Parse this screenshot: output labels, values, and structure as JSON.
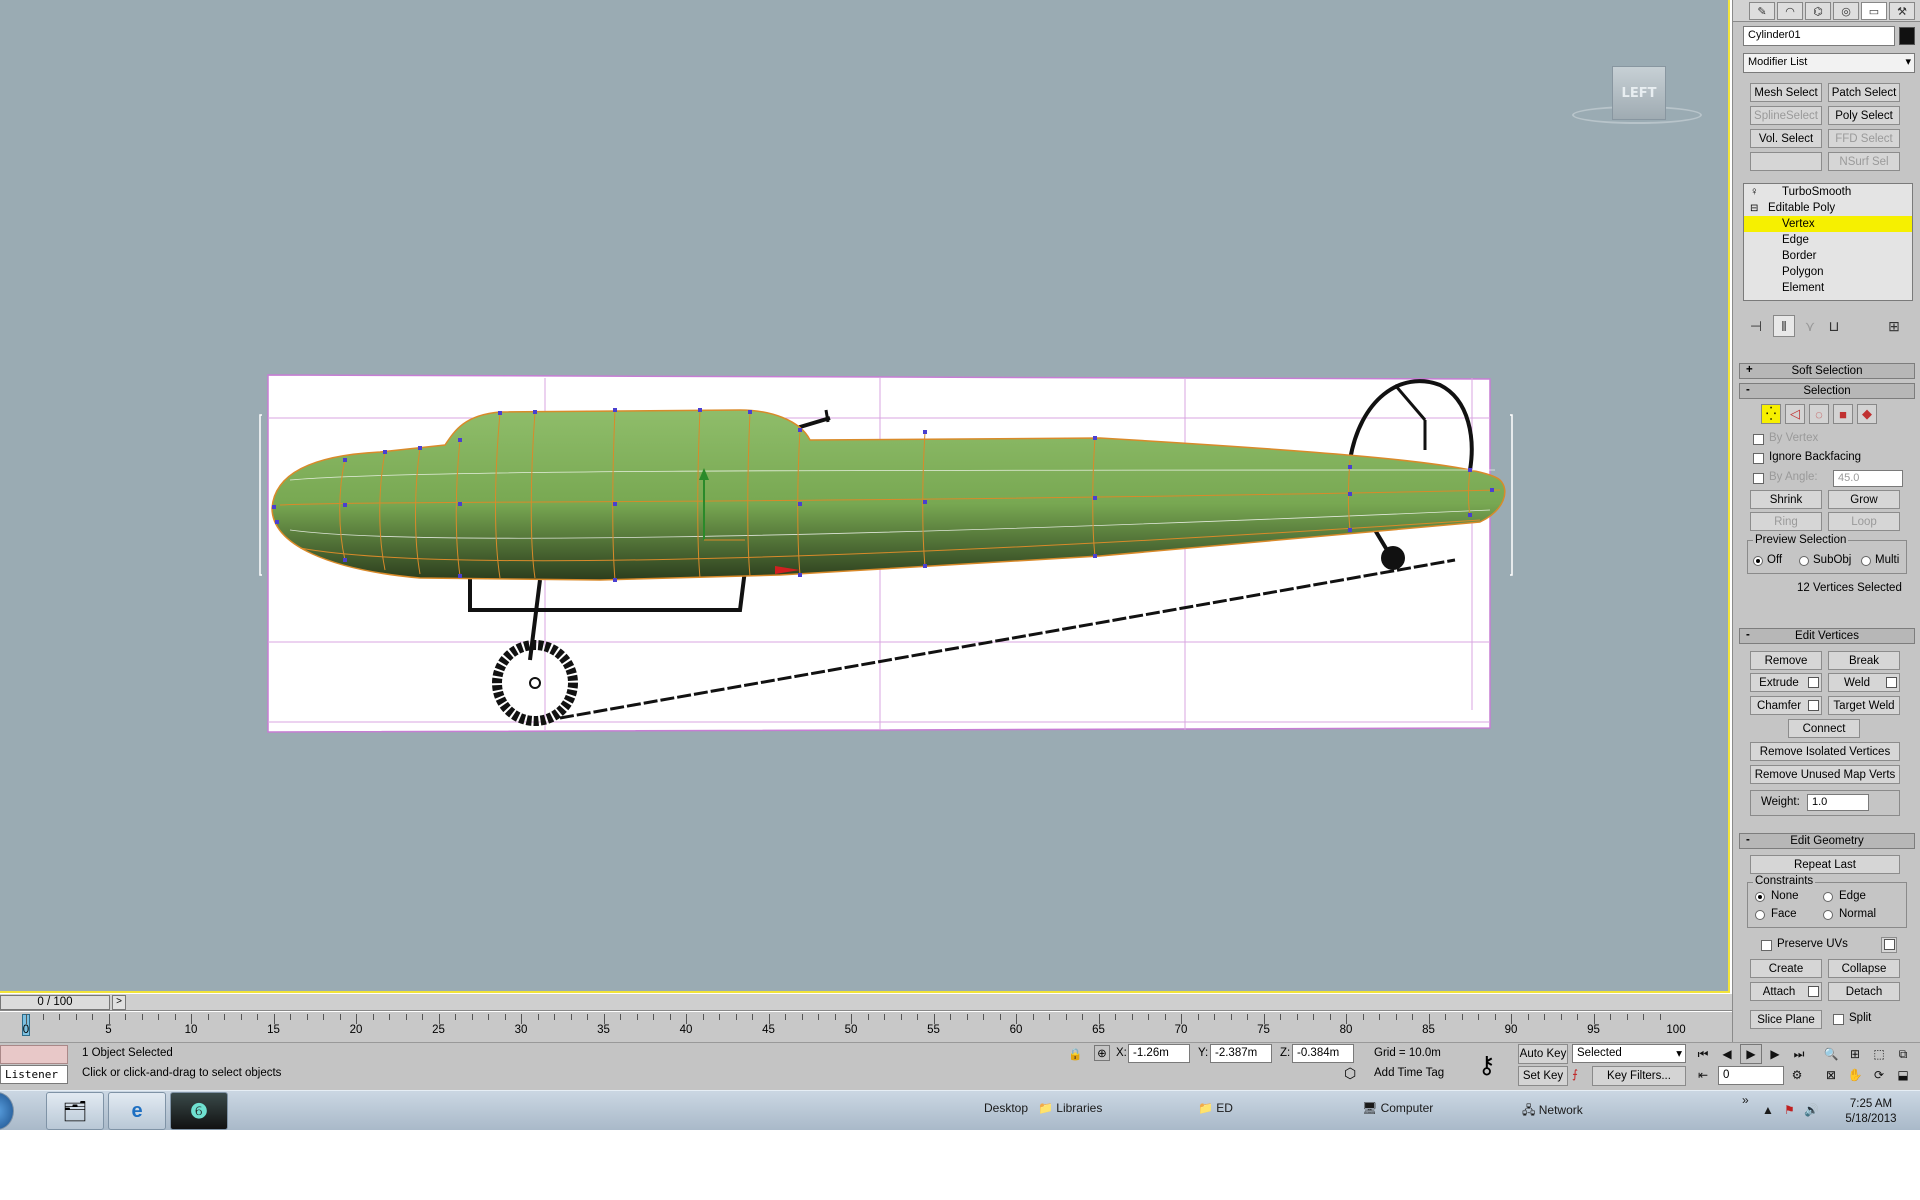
{
  "viewport": {
    "viewcube_label": "LEFT",
    "colors": {
      "background": "#9aabb3",
      "fuselage": "#7fae5a",
      "mesh_lines": "#d98a2a",
      "vertex": "#4a3fd0"
    }
  },
  "command_panel": {
    "tabs": [
      "create-icon",
      "modify-icon",
      "hierarchy-icon",
      "motion-icon",
      "display-icon",
      "utilities-icon"
    ],
    "object_name": "Cylinder01",
    "modifier_list": "Modifier List",
    "modifier_buttons": [
      {
        "label": "Mesh Select",
        "enabled": true
      },
      {
        "label": "Patch Select",
        "enabled": true
      },
      {
        "label": "SplineSelect",
        "enabled": false
      },
      {
        "label": "Poly Select",
        "enabled": true
      },
      {
        "label": "Vol. Select",
        "enabled": true
      },
      {
        "label": "FFD Select",
        "enabled": false
      },
      {
        "label": "",
        "enabled": false
      },
      {
        "label": "NSurf Sel",
        "enabled": false
      }
    ],
    "stack": {
      "turbosmooth": "TurboSmooth",
      "editable_poly": "Editable Poly",
      "subobjects": [
        "Vertex",
        "Edge",
        "Border",
        "Polygon",
        "Element"
      ],
      "selected": "Vertex"
    },
    "soft_selection": {
      "title": "Soft Selection",
      "sign": "+"
    },
    "selection": {
      "title": "Selection",
      "sign": "-",
      "by_vertex": "By Vertex",
      "ignore_backfacing": "Ignore Backfacing",
      "by_angle": "By Angle:",
      "angle_value": "45.0",
      "shrink": "Shrink",
      "grow": "Grow",
      "ring": "Ring",
      "loop": "Loop",
      "preview_selection": "Preview Selection",
      "preview_off": "Off",
      "preview_subobj": "SubObj",
      "preview_multi": "Multi",
      "status": "12 Vertices Selected"
    },
    "edit_vertices": {
      "title": "Edit Vertices",
      "sign": "-",
      "remove": "Remove",
      "break": "Break",
      "extrude": "Extrude",
      "weld": "Weld",
      "chamfer": "Chamfer",
      "target_weld": "Target Weld",
      "connect": "Connect",
      "remove_isolated": "Remove Isolated Vertices",
      "remove_unused": "Remove Unused Map Verts",
      "weight_label": "Weight:",
      "weight_value": "1.0"
    },
    "edit_geometry": {
      "title": "Edit Geometry",
      "sign": "-",
      "repeat_last": "Repeat Last",
      "constraints": "Constraints",
      "none": "None",
      "edge": "Edge",
      "face": "Face",
      "normal": "Normal",
      "preserve_uvs": "Preserve UVs",
      "create": "Create",
      "collapse": "Collapse",
      "attach": "Attach",
      "detach": "Detach",
      "slice_plane": "Slice Plane",
      "split": "Split"
    }
  },
  "timeline": {
    "frame": "0 / 100",
    "next": ">",
    "ticks": [
      "0",
      "5",
      "10",
      "15",
      "20",
      "25",
      "30",
      "35",
      "40",
      "45",
      "50",
      "55",
      "60",
      "65",
      "70",
      "75",
      "80",
      "85",
      "90",
      "95",
      "100"
    ]
  },
  "status_bar": {
    "listener": "Listener",
    "selection_status": "1 Object Selected",
    "prompt": "Click or click-and-drag to select objects",
    "x_label": "X:",
    "x_value": "-1.26m",
    "y_label": "Y:",
    "y_value": "-2.387m",
    "z_label": "Z:",
    "z_value": "-0.384m",
    "grid": "Grid = 10.0m",
    "add_time_tag": "Add Time Tag",
    "auto_key": "Auto Key",
    "set_key": "Set Key",
    "key_mode": "Selected",
    "key_filters": "Key Filters...",
    "frame_value": "0"
  },
  "taskbar": {
    "apps": [
      "explorer-icon",
      "internet-explorer-icon",
      "3dsmax-icon"
    ],
    "links": [
      "Desktop",
      "Libraries",
      "ED",
      "Computer",
      "Network"
    ],
    "time": "7:25 AM",
    "date": "5/18/2013"
  }
}
